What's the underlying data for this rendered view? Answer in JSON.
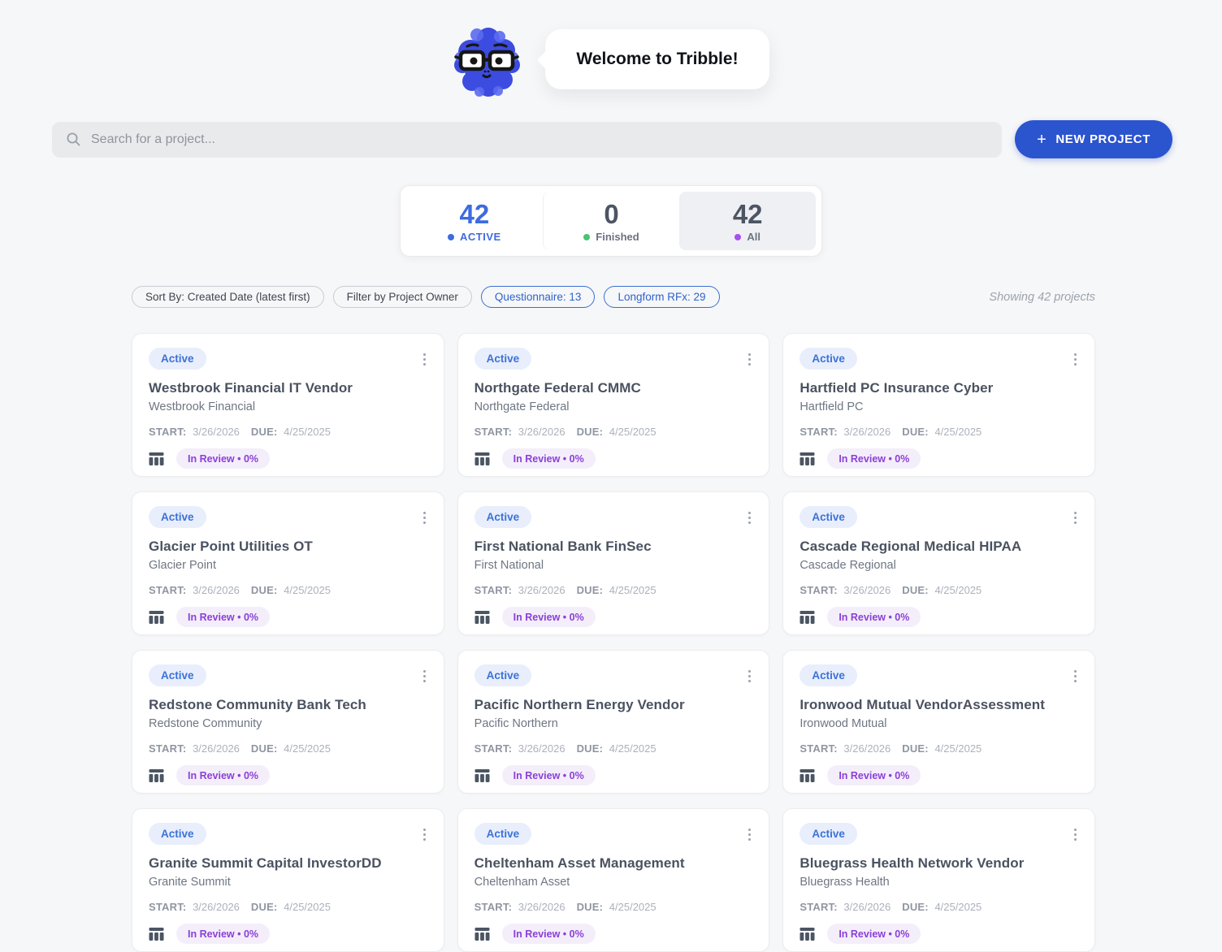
{
  "colors": {
    "brand_blue": "#2b54cf",
    "stat_blue": "#3e6be0",
    "finished_green": "#4bc46d",
    "all_purple": "#a74ff0",
    "active_badge_bg": "#e8eefb",
    "active_badge_text": "#3b72d8",
    "review_badge_bg": "#f4eefa",
    "review_badge_text": "#8b3fd9",
    "mascot_blue": "#3c4ce0",
    "mascot_blue_light": "#5b6cf0"
  },
  "icons": {
    "search": "magnifier",
    "plus": "+",
    "kebab": "three-vertical-dots",
    "table": "table-columns",
    "mascot": "blue-blob-with-glasses"
  },
  "header": {
    "welcome_text": "Welcome to Tribble!"
  },
  "search": {
    "placeholder": "Search for a project..."
  },
  "toolbar": {
    "new_project_label": "NEW PROJECT",
    "plus_glyph": "+"
  },
  "stats": [
    {
      "value": "42",
      "label": "ACTIVE"
    },
    {
      "value": "0",
      "label": "Finished"
    },
    {
      "value": "42",
      "label": "All"
    }
  ],
  "filters": {
    "sort": "Sort By: Created Date (latest first)",
    "owner": "Filter by Project Owner",
    "questionnaire": "Questionnaire: 13",
    "longform": "Longform RFx: 29",
    "showing": "Showing 42 projects"
  },
  "card_labels": {
    "start": "START:",
    "due": "DUE:"
  },
  "projects": [
    {
      "status": "Active",
      "title": "Westbrook Financial IT Vendor",
      "subtitle": "Westbrook Financial",
      "start": "3/26/2026",
      "due": "4/25/2025",
      "review": "In Review • 0%"
    },
    {
      "status": "Active",
      "title": "Northgate Federal CMMC",
      "subtitle": "Northgate Federal",
      "start": "3/26/2026",
      "due": "4/25/2025",
      "review": "In Review • 0%"
    },
    {
      "status": "Active",
      "title": "Hartfield PC Insurance Cyber",
      "subtitle": "Hartfield PC",
      "start": "3/26/2026",
      "due": "4/25/2025",
      "review": "In Review • 0%"
    },
    {
      "status": "Active",
      "title": "Glacier Point Utilities OT",
      "subtitle": "Glacier Point",
      "start": "3/26/2026",
      "due": "4/25/2025",
      "review": "In Review • 0%"
    },
    {
      "status": "Active",
      "title": "First National Bank FinSec",
      "subtitle": "First National",
      "start": "3/26/2026",
      "due": "4/25/2025",
      "review": "In Review • 0%"
    },
    {
      "status": "Active",
      "title": "Cascade Regional Medical HIPAA",
      "subtitle": "Cascade Regional",
      "start": "3/26/2026",
      "due": "4/25/2025",
      "review": "In Review • 0%"
    },
    {
      "status": "Active",
      "title": "Redstone Community Bank Tech",
      "subtitle": "Redstone Community",
      "start": "3/26/2026",
      "due": "4/25/2025",
      "review": "In Review • 0%"
    },
    {
      "status": "Active",
      "title": "Pacific Northern Energy Vendor",
      "subtitle": "Pacific Northern",
      "start": "3/26/2026",
      "due": "4/25/2025",
      "review": "In Review • 0%"
    },
    {
      "status": "Active",
      "title": "Ironwood Mutual VendorAssessment",
      "subtitle": "Ironwood Mutual",
      "start": "3/26/2026",
      "due": "4/25/2025",
      "review": "In Review • 0%"
    },
    {
      "status": "Active",
      "title": "Granite Summit Capital InvestorDD",
      "subtitle": "Granite Summit",
      "start": "3/26/2026",
      "due": "4/25/2025",
      "review": "In Review • 0%"
    },
    {
      "status": "Active",
      "title": "Cheltenham Asset Management",
      "subtitle": "Cheltenham Asset",
      "start": "3/26/2026",
      "due": "4/25/2025",
      "review": "In Review • 0%"
    },
    {
      "status": "Active",
      "title": "Bluegrass Health Network Vendor",
      "subtitle": "Bluegrass Health",
      "start": "3/26/2026",
      "due": "4/25/2025",
      "review": "In Review • 0%"
    }
  ]
}
